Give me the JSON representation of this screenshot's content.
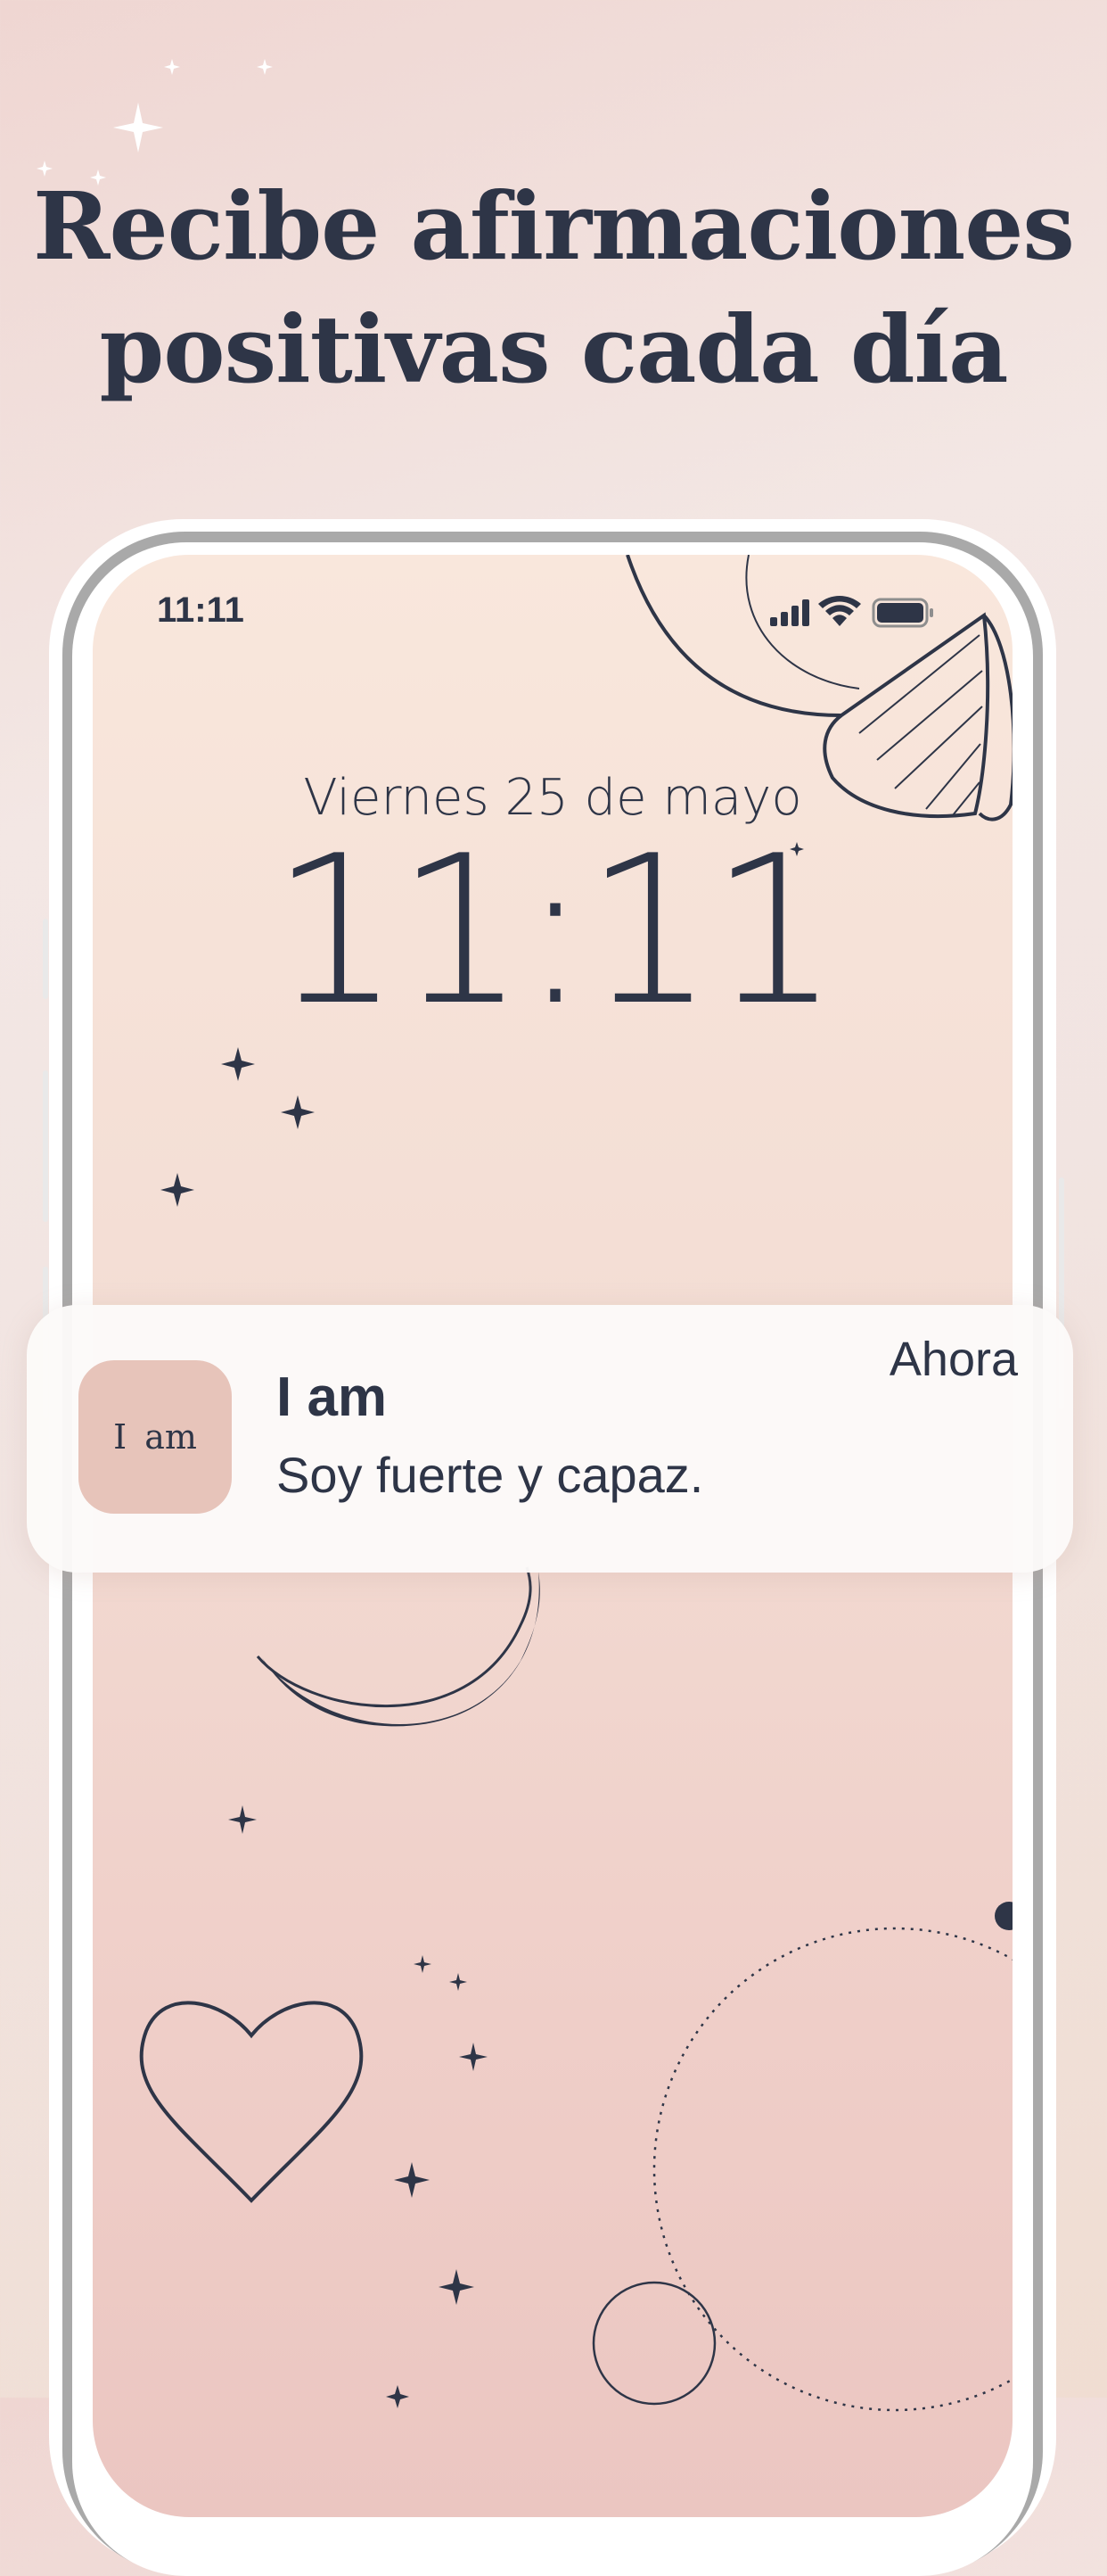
{
  "headline": {
    "line1": "Recibe afirmaciones",
    "line2": "positivas cada día"
  },
  "status_bar": {
    "time": "11:11",
    "icons": [
      "signal-icon",
      "wifi-icon",
      "battery-icon"
    ]
  },
  "lock_screen": {
    "date": "Viernes 25 de mayo",
    "time": "11:11"
  },
  "notification": {
    "app_icon_text": "I am",
    "title": "I am",
    "body": "Soy fuerte y capaz.",
    "time": "Ahora"
  },
  "colors": {
    "ink": "#2e3547",
    "app_icon_bg": "#e7c4ba",
    "notification_bg": "#fcfaf9"
  }
}
